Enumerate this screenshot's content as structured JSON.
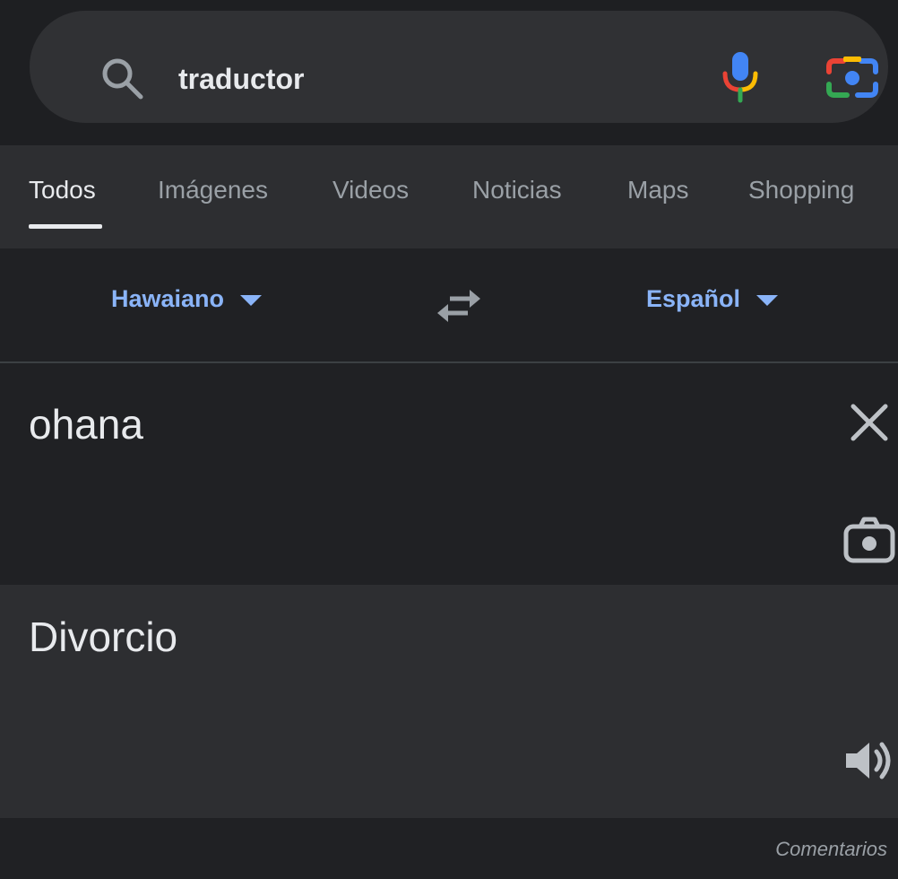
{
  "search": {
    "query": "traductor",
    "icons": [
      "search-icon",
      "microphone-icon",
      "camera-lens-icon"
    ]
  },
  "tabs": [
    {
      "label": "Todos",
      "active": true
    },
    {
      "label": "Imágenes",
      "active": false
    },
    {
      "label": "Videos",
      "active": false
    },
    {
      "label": "Noticias",
      "active": false
    },
    {
      "label": "Maps",
      "active": false
    },
    {
      "label": "Shopping",
      "active": false
    }
  ],
  "translator": {
    "source_language": "Hawaiano",
    "target_language": "Español",
    "source_text": "ohana",
    "translated_text": "Divorcio",
    "icons": [
      "swap-icon",
      "close-icon",
      "camera-icon",
      "speaker-icon"
    ]
  },
  "footer": {
    "feedback_label": "Comentarios"
  },
  "colors": {
    "background": "#202124",
    "panel": "#2d2e31",
    "search_bar": "#303134",
    "link_blue": "#8ab4f8",
    "text_primary": "#e8eaed",
    "text_secondary": "#9aa0a6"
  }
}
